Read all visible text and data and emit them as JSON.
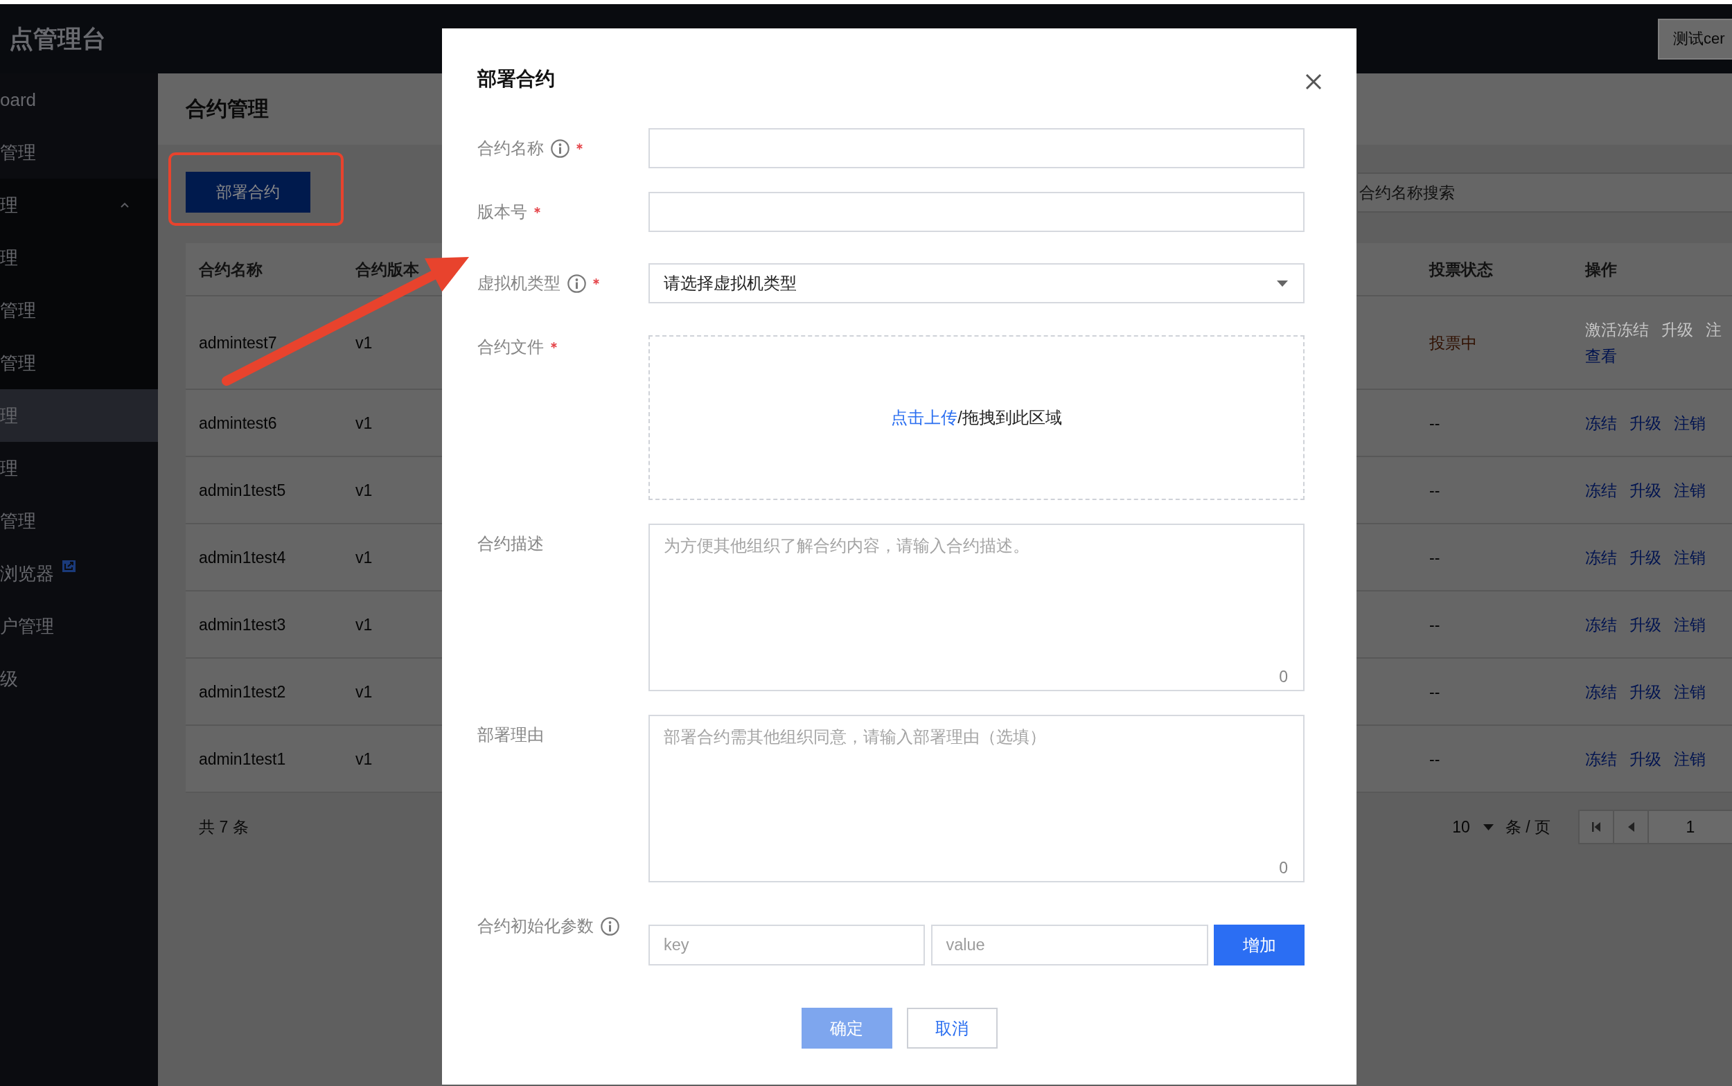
{
  "header": {
    "title": "点管理台",
    "account_button": "测试cer"
  },
  "sidebar": {
    "items": [
      {
        "label": "oard",
        "selected": false,
        "external": false
      },
      {
        "label": "管理",
        "selected": false,
        "external": false
      },
      {
        "label": "理",
        "selected": false,
        "external": false,
        "expanded": true,
        "children": [
          {
            "label": "理",
            "selected": false
          },
          {
            "label": "管理",
            "selected": false
          },
          {
            "label": "管理",
            "selected": false
          }
        ]
      },
      {
        "label": "理",
        "selected": true,
        "external": false
      },
      {
        "label": "理",
        "selected": false,
        "external": false
      },
      {
        "label": "管理",
        "selected": false,
        "external": false
      },
      {
        "label": "浏览器",
        "selected": false,
        "external": true
      },
      {
        "label": "户管理",
        "selected": false,
        "external": false
      },
      {
        "label": "级",
        "selected": false,
        "external": false
      }
    ]
  },
  "page": {
    "title": "合约管理",
    "deploy_button": "部署合约",
    "search": {
      "placeholder": "合约名称搜索"
    }
  },
  "table": {
    "columns": [
      {
        "label": "合约名称"
      },
      {
        "label": "合约版本"
      },
      {
        "label": "投票状态"
      },
      {
        "label": "操作"
      }
    ],
    "rows": [
      {
        "name": "admintest7",
        "version": "v1",
        "vote_status": "投票中",
        "voting": true,
        "actions": [
          {
            "label": "激活冻结",
            "disabled": true
          },
          {
            "label": "升级",
            "disabled": true
          },
          {
            "label": "注",
            "disabled": true
          },
          {
            "label": "查看",
            "disabled": false
          }
        ]
      },
      {
        "name": "admintest6",
        "version": "v1",
        "vote_status": "--",
        "voting": false,
        "actions": [
          {
            "label": "冻结",
            "disabled": false
          },
          {
            "label": "升级",
            "disabled": false
          },
          {
            "label": "注销",
            "disabled": false
          }
        ]
      },
      {
        "name": "admin1test5",
        "version": "v1",
        "vote_status": "--",
        "voting": false,
        "actions": [
          {
            "label": "冻结",
            "disabled": false
          },
          {
            "label": "升级",
            "disabled": false
          },
          {
            "label": "注销",
            "disabled": false
          }
        ]
      },
      {
        "name": "admin1test4",
        "version": "v1",
        "vote_status": "--",
        "voting": false,
        "actions": [
          {
            "label": "冻结",
            "disabled": false
          },
          {
            "label": "升级",
            "disabled": false
          },
          {
            "label": "注销",
            "disabled": false
          }
        ]
      },
      {
        "name": "admin1test3",
        "version": "v1",
        "vote_status": "--",
        "voting": false,
        "actions": [
          {
            "label": "冻结",
            "disabled": false
          },
          {
            "label": "升级",
            "disabled": false
          },
          {
            "label": "注销",
            "disabled": false
          }
        ]
      },
      {
        "name": "admin1test2",
        "version": "v1",
        "vote_status": "--",
        "voting": false,
        "actions": [
          {
            "label": "冻结",
            "disabled": false
          },
          {
            "label": "升级",
            "disabled": false
          },
          {
            "label": "注销",
            "disabled": false
          }
        ]
      },
      {
        "name": "admin1test1",
        "version": "v1",
        "vote_status": "--",
        "voting": false,
        "actions": [
          {
            "label": "冻结",
            "disabled": false
          },
          {
            "label": "升级",
            "disabled": false
          },
          {
            "label": "注销",
            "disabled": false
          }
        ]
      }
    ]
  },
  "pagination": {
    "total": "共 7 条",
    "page_size": "10",
    "page_size_unit": "条 / 页",
    "page": "1"
  },
  "modal": {
    "title": "部署合约",
    "fields": [
      {
        "kind": "input",
        "label": "合约名称",
        "info": true,
        "required": true
      },
      {
        "kind": "input",
        "label": "版本号",
        "info": false,
        "required": true
      },
      {
        "kind": "select",
        "label": "虚拟机类型",
        "info": true,
        "required": true,
        "placeholder": "请选择虚拟机类型"
      },
      {
        "kind": "upload",
        "label": "合约文件",
        "info": false,
        "required": true,
        "link": "点击上传",
        "text": "/拖拽到此区域"
      },
      {
        "kind": "textarea",
        "label": "合约描述",
        "info": false,
        "required": false,
        "placeholder": "为方便其他组织了解合约内容，请输入合约描述。",
        "count": "0"
      },
      {
        "kind": "textarea",
        "label": "部署理由",
        "info": false,
        "required": false,
        "placeholder": "部署合约需其他组织同意，请输入部署理由（选填）",
        "count": "0"
      },
      {
        "kind": "params",
        "label": "合约初始化参数",
        "info": true,
        "required": false,
        "key_placeholder": "key",
        "value_placeholder": "value",
        "button": "增加"
      }
    ],
    "buttons": [
      {
        "label": "确定",
        "kind": "primary",
        "disabled": true
      },
      {
        "label": "取消",
        "kind": "secondary",
        "disabled": false
      }
    ]
  }
}
